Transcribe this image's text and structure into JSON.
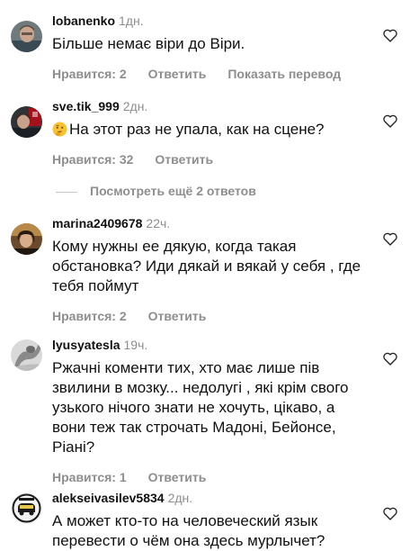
{
  "actions": {
    "reply": "Ответить",
    "translate": "Показать перевод"
  },
  "more_replies": "Посмотреть ещё 2 ответов",
  "comments": [
    {
      "username": "lobanenko",
      "time": "1дн.",
      "text_lines": [
        "Більше немає віри до Віри."
      ],
      "likes": "Нравится: 2",
      "show_translate": true
    },
    {
      "username": "sve.tik_999",
      "time": "2дн.",
      "emoji": "thinking-face",
      "text_lines": [
        "На этот раз не упала, как на сцене?"
      ],
      "likes": "Нравится: 32",
      "show_translate": false
    },
    {
      "username": "marina2409678",
      "time": "22ч.",
      "text_lines": [
        "Кому нужны ее дякую, когда такая",
        "обстановка? Иди дякай и вякай у себя , где",
        "тебя поймут"
      ],
      "likes": "Нравится: 2",
      "show_translate": false
    },
    {
      "username": "lyusyatesla",
      "time": "19ч.",
      "text_lines": [
        "Ржачні коменти тих, хто має лише пів",
        "звилини в мозку... недолугі , які крім свого",
        "узького нічого знати не хочуть, цікаво, а",
        "вони теж так строчать Мадоні, Бейонсе,",
        "Ріані?"
      ],
      "likes": "Нравится: 1",
      "show_translate": false
    },
    {
      "username": "alekseivasilev5834",
      "time": "2дн.",
      "text_lines": [
        "А может кто-то на человеческий язык",
        "перевести о чём она здесь мурлычет?"
      ],
      "likes": "",
      "show_translate": false
    }
  ]
}
